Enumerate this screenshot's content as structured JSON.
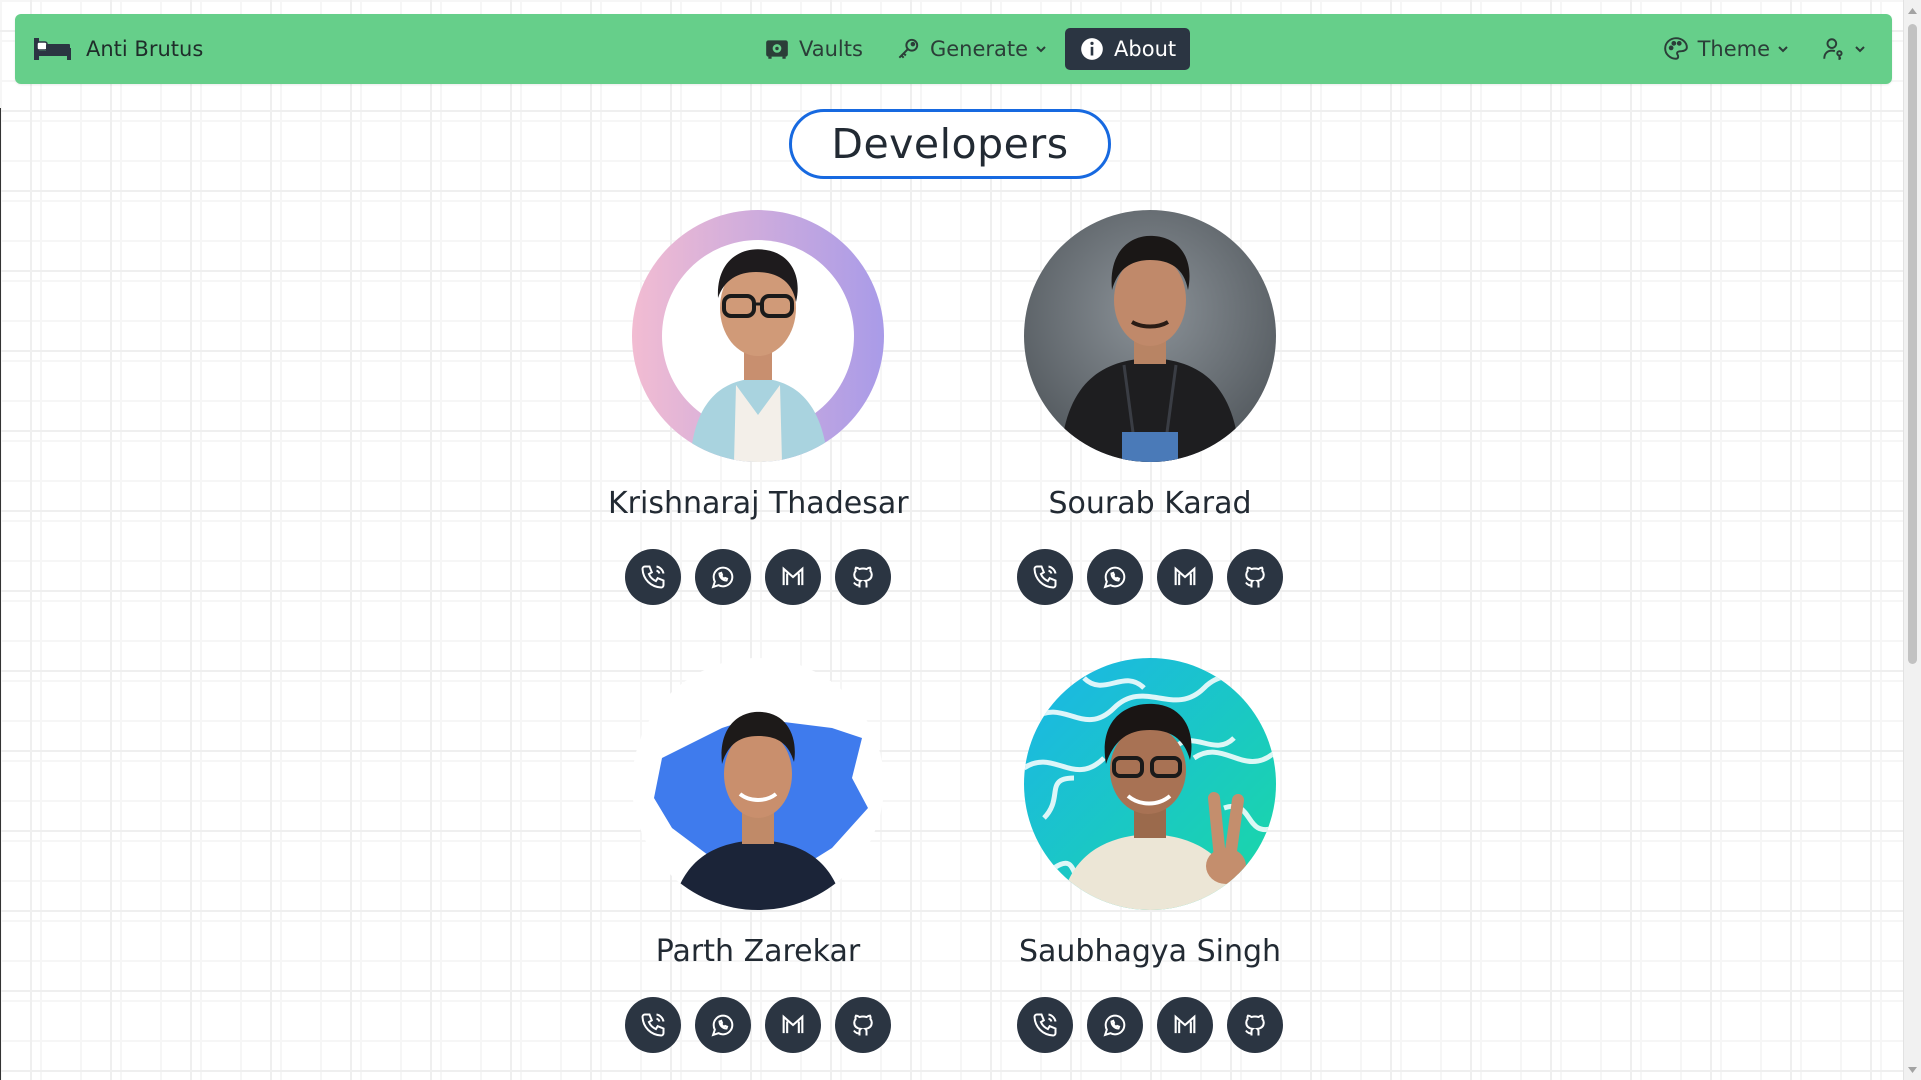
{
  "app": {
    "title": "Anti Brutus"
  },
  "nav": {
    "vaults": "Vaults",
    "generate": "Generate",
    "about": "About",
    "theme": "Theme"
  },
  "page": {
    "heading": "Developers"
  },
  "developers": [
    {
      "name": "Krishnaraj Thadesar"
    },
    {
      "name": "Sourab Karad"
    },
    {
      "name": "Parth Zarekar"
    },
    {
      "name": "Saubhagya Singh"
    }
  ],
  "social_icons": [
    "phone-icon",
    "whatsapp-icon",
    "gmail-icon",
    "github-icon"
  ],
  "colors": {
    "navbar": "#66cf8a",
    "active_nav": "#2b3542",
    "title_border": "#1769e0",
    "social_button": "#2b3542"
  }
}
